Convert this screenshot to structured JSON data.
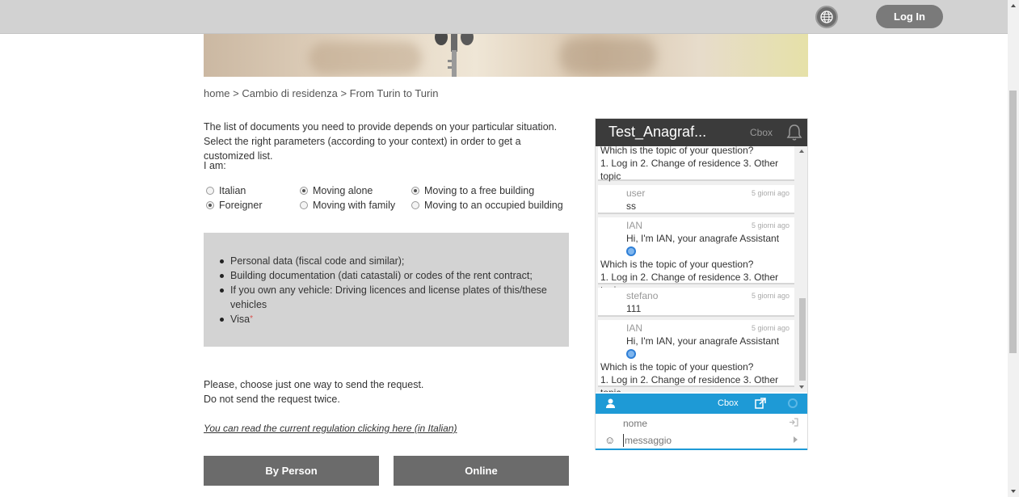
{
  "header": {
    "globe_icon": "globe-icon",
    "login_label": "Log In"
  },
  "breadcrumb": "home > Cambio di residenza > From Turin to Turin",
  "intro": "The list of documents you need to provide depends on your particular situation. Select the right parameters (according to your context) in order to get a customized list.",
  "iam_label": "I am:",
  "options": {
    "italian": "Italian",
    "foreigner": "Foreigner",
    "moving_alone": "Moving alone",
    "moving_family": "Moving with family",
    "free_building": "Moving to a free building",
    "occupied_building": "Moving to an occupied building",
    "selected": [
      "foreigner",
      "moving_alone",
      "free_building"
    ]
  },
  "documents": [
    "Personal data (fiscal code and similar);",
    "Building documentation (dati catastali) or codes of the rent contract;",
    "If you own any vehicle: Driving licences and license plates of this/these vehicles",
    "Visa"
  ],
  "required_mark": "*",
  "choose_line1": "Please, choose just one way to send the request.",
  "choose_line2": "Do not send the request twice.",
  "regulation_link": "You can read the current regulation clicking here (in Italian)",
  "buttons": {
    "by_person": "By Person",
    "online": "Online"
  },
  "chat": {
    "title": "Test_Anagraf...",
    "cbox": "Cbox",
    "bell_icon": "bell-icon",
    "messages": [
      {
        "who": "",
        "when": "",
        "line1": "Which is the topic of your question?",
        "line2": "1. Log in 2. Change of residence 3. Other",
        "line3": "topic"
      },
      {
        "who": "user",
        "when": "5 giorni ago",
        "line1": "ss"
      },
      {
        "who": "IAN",
        "when": "5 giorni ago",
        "greeting": "Hi, I'm IAN, your anagrafe Assistant",
        "line1": "Which is the topic of your question?",
        "line2": "1. Log in 2. Change of residence 3. Other",
        "line3": "topic"
      },
      {
        "who": "stefano",
        "when": "5 giorni ago",
        "line1": "111"
      },
      {
        "who": "IAN",
        "when": "5 giorni ago",
        "greeting": "Hi, I'm IAN, your anagrafe Assistant",
        "line1": "Which is the topic of your question?",
        "line2": "1. Log in 2. Change of residence 3. Other",
        "line3": "topic"
      }
    ],
    "bar_cbox": "Cbox",
    "name_placeholder": "nome",
    "message_placeholder": "messaggio"
  },
  "colors": {
    "accent_blue": "#1e9ad6",
    "button_gray": "#6b6b6b",
    "chat_header": "#3b3b3b"
  }
}
